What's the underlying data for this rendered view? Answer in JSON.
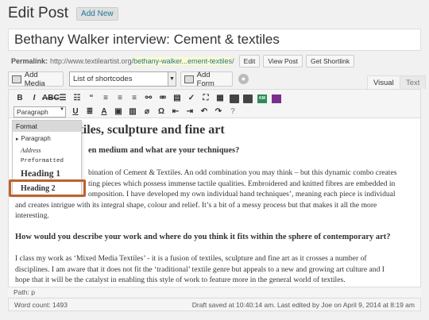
{
  "header": {
    "title": "Edit Post",
    "add_new": "Add New"
  },
  "post_title": "Bethany Walker interview: Cement & textiles",
  "permalink": {
    "label": "Permalink:",
    "base": "http://www.textileartist.org/",
    "slug": "bethany-walker...ement-textiles",
    "trailing": "/",
    "buttons": [
      "Edit",
      "View Post",
      "Get Shortlink"
    ]
  },
  "media_row": {
    "add_media": "Add Media",
    "shortcodes": "List of shortcodes",
    "add_form": "Add Form",
    "tabs": [
      "Visual",
      "Text"
    ]
  },
  "toolbar": {
    "format_select": "Paragraph",
    "icons_row1": [
      "bold-icon",
      "italic-icon",
      "strikethrough-icon",
      "bullet-list-icon",
      "numbered-list-icon",
      "blockquote-icon",
      "align-left-icon",
      "align-center-icon",
      "align-right-icon",
      "link-icon",
      "unlink-icon",
      "more-tag-icon",
      "proofread-icon",
      "fullscreen-icon",
      "toolbar-toggle-icon",
      "table-icon",
      "columns-icon",
      "plugin-green-icon",
      "plugin-purple-icon"
    ],
    "icons_row2": [
      "underline-icon",
      "justify-icon",
      "text-color-icon",
      "paste-text-icon",
      "paste-word-icon",
      "clear-formatting-icon",
      "omega-icon",
      "outdent-icon",
      "indent-icon",
      "undo-icon",
      "redo-icon",
      "help-icon"
    ]
  },
  "dropdown": {
    "header": "Format",
    "items": [
      "Paragraph",
      "Address",
      "Preformatted",
      "Heading 1",
      "Heading 2"
    ]
  },
  "content": {
    "heading": "textiles, sculpture and fine art",
    "q1": "en medium and what are your techniques?",
    "para1": [
      "bination of Cement & Textiles. An odd combination you may think – but this dynamic combo creates",
      "ting pieces which possess immense tactile qualities. Embroidered and knitted fibres are embedded in",
      "omposition. I have developed my own individual hand techniques’, meaning each piece is individual",
      "and creates intrigue with its integral shape, colour and relief. It’s a bit of a messy process but that makes it all the more",
      "interesting."
    ],
    "q2": "How would you describe your work and where do you think it fits within the sphere of contemporary art?",
    "para2": [
      "I class my work as ‘Mixed Media Textiles’ -  it is a fusion of textiles, sculpture and fine art as it crosses a number of",
      "disciplines. I am aware that it does not fit the ‘traditional’ textile genre but appeals to a new and growing art culture and I",
      "hope that it will be the catalyst in enabling this style of work to feature more in the general world of textiles."
    ]
  },
  "path": "Path: p",
  "status": {
    "word_count": "Word count: 1493",
    "saved": "Draft saved at 10:40:14 am. Last edited by Joe on April 9, 2014 at 8:19 am"
  }
}
